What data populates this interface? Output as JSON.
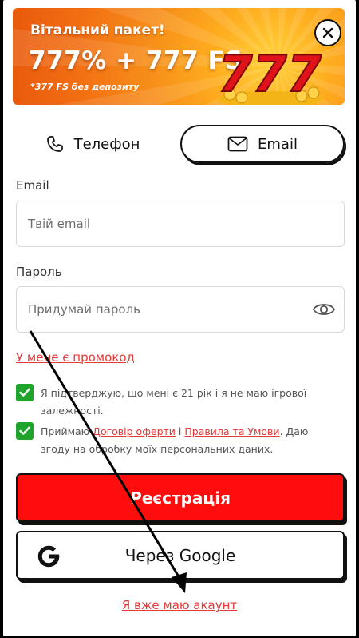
{
  "banner": {
    "title": "Вітальний пакет!",
    "headline": "777% + 777 FS",
    "note": "*377 FS без депозиту",
    "art_text": "777"
  },
  "tabs": [
    {
      "label": "Телефон",
      "icon": "phone-icon",
      "selected": false
    },
    {
      "label": "Email",
      "icon": "envelope-icon",
      "selected": true
    }
  ],
  "form": {
    "email_label": "Email",
    "email_placeholder": "Твій email",
    "password_label": "Пароль",
    "password_placeholder": "Придумай пароль",
    "promo_link": "У мене є промокод"
  },
  "consents": [
    {
      "checked": true,
      "text": "Я підтверджую, що мені є 21 рік і я не маю ігрової залежності."
    },
    {
      "checked": true,
      "prefix": "Приймаю ",
      "link1": "Договір оферти",
      "middle": " і ",
      "link2": "Правила та Умови",
      "suffix": ". Даю згоду на обробку моїх персональних даних."
    }
  ],
  "buttons": {
    "register": "Реєстрація",
    "google": "Через Google"
  },
  "login_link": "Я вже маю акаунт",
  "colors": {
    "accent_red": "#ff0d0d",
    "link_red": "#e53935",
    "check_green": "#1fa42c",
    "banner_orange": "#f7901a"
  }
}
